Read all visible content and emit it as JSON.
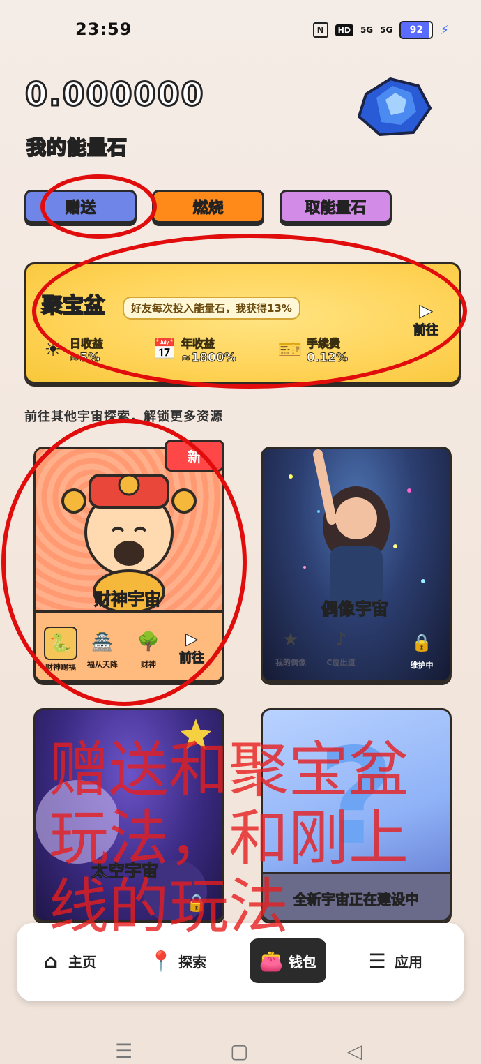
{
  "status_bar": {
    "time": "23:59",
    "nfc": "N",
    "hd": "HD",
    "signal_1": "5G",
    "signal_2": "5G",
    "battery": "92"
  },
  "header": {
    "balance": "0.000000",
    "label": "我的能量石",
    "gem_icon": "blue-gem-icon"
  },
  "actions": {
    "give": "赠送",
    "burn": "燃烧",
    "take": "取能量石"
  },
  "treasure": {
    "title": "聚宝盆",
    "desc": "好友每次投入能量石，我获得13%",
    "go_label": "前往",
    "stats": [
      {
        "label": "日收益",
        "value": "≈5%",
        "icon": "sun-icon"
      },
      {
        "label": "年收益",
        "value": "≈1800%",
        "icon": "calendar-icon"
      },
      {
        "label": "手续费",
        "value": "0.12%",
        "icon": "ticket-icon"
      }
    ]
  },
  "section_title": "前往其他宇宙探索，解锁更多资源",
  "universes": {
    "wealth": {
      "badge": "新",
      "name": "财神宇宙",
      "items": [
        "财神赐福",
        "福从天降",
        "财神"
      ],
      "go_label": "前往"
    },
    "idol": {
      "name": "偶像宇宙",
      "items": [
        "我的偶像",
        "C位出道"
      ],
      "status": "维护中"
    },
    "space": {
      "name": "太空宇宙"
    },
    "new": {
      "banner": "全新宇宙正在建设中"
    }
  },
  "bottom_nav": {
    "items": [
      "主页",
      "探索",
      "钱包",
      "应用"
    ]
  },
  "annotation_text": "赠送和聚宝盆玩法，和刚上线的玩法",
  "colors": {
    "accent_red": "#e10d0d",
    "give_blue": "#6f86e8",
    "burn_orange": "#ff8a1a",
    "take_purple": "#d38be8",
    "treasure_yellow": "#ffd45a"
  }
}
